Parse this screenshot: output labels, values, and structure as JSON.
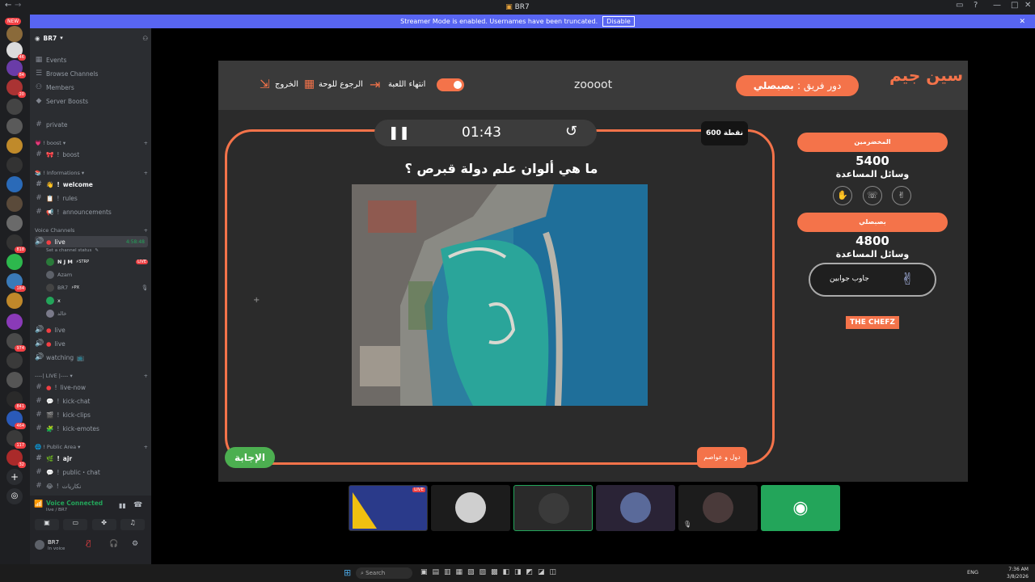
{
  "window": {
    "title": "BR7",
    "controls": [
      "back-icon",
      "forward-icon",
      "inbox-icon",
      "help-icon",
      "minimize-icon",
      "maximize-icon",
      "close-icon"
    ]
  },
  "streamer_banner": {
    "text": "Streamer Mode is enabled. Usernames have been truncated.",
    "button": "Disable",
    "close": "✕"
  },
  "server_rail": {
    "new_tag": "NEW",
    "badges": [
      "46",
      "84",
      "20",
      "818",
      "184",
      "974",
      "841",
      "464",
      "117",
      "32"
    ]
  },
  "server": {
    "name": "BR7",
    "menu": [
      "Events",
      "Browse Channels",
      "Members",
      "Server Boosts"
    ],
    "channels": {
      "private": "private",
      "boost_category": "boost",
      "boost": "boost",
      "info_category": "Informations",
      "welcome": "welcome",
      "rules": "rules",
      "announcements": "announcements",
      "voice_category": "Voice Channels",
      "voice_live": "live",
      "voice_live_time": "4:58:48",
      "voice_status": "Set a channel status",
      "users": [
        {
          "name": "N J M",
          "tag": "STRP",
          "live": "LIVE"
        },
        {
          "name": "Azam",
          "tag": "",
          "live": ""
        },
        {
          "name": "BR7",
          "tag": "PX",
          "live": ""
        },
        {
          "name": "x",
          "tag": "",
          "live": ""
        },
        {
          "name": "خالد",
          "tag": "",
          "live": ""
        }
      ],
      "live2": "live",
      "live3": "live",
      "watching": "watching",
      "live_category": "----| LIVE |----",
      "live_now": "live-now",
      "kick_chat": "kick-chat",
      "kick_clips": "kick-clips",
      "kick_emotes": "kick-emotes",
      "public_category": "Public Area",
      "ajr": "ajr",
      "public_chat": "public・chat",
      "last": "نكاريات"
    },
    "voice_connected": {
      "title": "Voice Connected",
      "subtitle": "live / BR7"
    },
    "user": {
      "name": "BR7",
      "status": "In voice"
    }
  },
  "game": {
    "logo": "سين جيم",
    "turn_label": "دور فريق :",
    "turn_team": "بصبصلي",
    "game_name": "zoooot",
    "end_game": "انتهاء اللعبة",
    "back_to_board": "الرجوع للوحة",
    "exit": "الخروج",
    "timer": "01:43",
    "points": "600 نقطة",
    "question": "ما هي ألوان علم دولة قبرص ؟",
    "answer_button": "الإجابة",
    "category": "دول و عواصم",
    "team1": {
      "name": "المخضرمين",
      "score": "5400",
      "helpers": "وسائل المساعدة"
    },
    "team2": {
      "name": "بصبصلي",
      "score": "4800",
      "helpers": "وسائل المساعدة",
      "helper_button": "جاوب جوابين"
    },
    "sponsor": "THE CHEFZ"
  },
  "stream_tiles": {
    "live_label": "LIVE"
  },
  "taskbar": {
    "search": "Search",
    "lang": "ENG",
    "time": "7:36 AM",
    "date": "3/8/2026"
  }
}
